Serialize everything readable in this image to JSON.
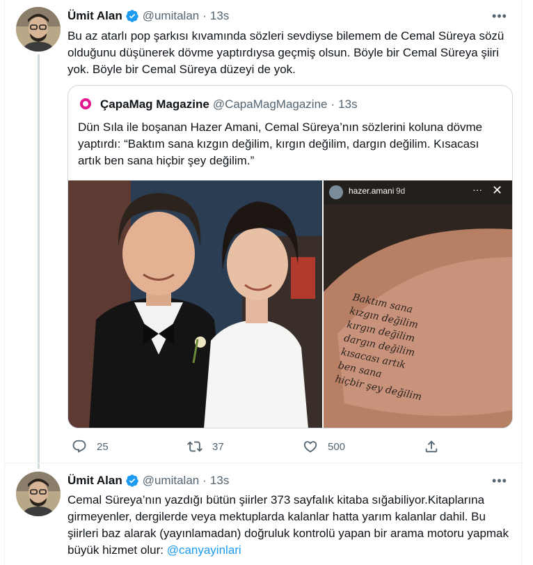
{
  "tweets": [
    {
      "author": {
        "name": "Ümit Alan",
        "handle": "@umitalan",
        "dot": "·",
        "time": "13s"
      },
      "more": "•••",
      "text": "Bu az atarlı pop şarkısı kıvamında sözleri sevdiyse bilemem de Cemal Süreya sözü olduğunu düşünerek dövme yaptırdıysa geçmiş olsun. Böyle bir Cemal Süreya şiiri yok. Böyle bir Cemal Süreya düzeyi de yok.",
      "quote": {
        "author": {
          "name": "ÇapaMag Magazine",
          "handle": "@CapaMagMagazine",
          "dot": "·",
          "time": "13s"
        },
        "text": "Dün Sıla ile boşanan Hazer Amani, Cemal Süreya’nın sözlerini koluna dövme yaptırdı: “Baktım sana kızgın değilim, kırgın değilim, dargın değilim. Kısacası artık ben sana hiçbir şey değilim.”",
        "story": {
          "user": "hazer.amani",
          "age": "9d",
          "more": "···",
          "close": "✕"
        },
        "tattoo_lines": [
          "Baktım sana",
          "kızgın değilim",
          "kırgın değilim",
          "dargın değilim",
          "kısacası artık",
          "ben sana",
          "hiçbir şey değilim"
        ]
      },
      "stats": {
        "replies": "25",
        "retweets": "37",
        "likes": "500"
      }
    },
    {
      "author": {
        "name": "Ümit Alan",
        "handle": "@umitalan",
        "dot": "·",
        "time": "13s"
      },
      "more": "•••",
      "text": "Cemal Süreya’nın yazdığı bütün şiirler 373 sayfalık kitaba sığabiliyor.Kitaplarına girmeyenler, dergilerde veya mektuplarda kalanlar hatta yarım kalanlar dahil. Bu şiirleri baz alarak (yayınlamadan) doğruluk kontrolü yapan bir arama motoru yapmak büyük hizmet olur: ",
      "mention": "@canyayinlari"
    }
  ],
  "colors": {
    "verified": "#1d9bf0",
    "muted": "#536471",
    "border": "#cfd9de",
    "link": "#1d9bf0",
    "capamag_logo": "#e4158f"
  },
  "icons": [
    "verified-badge-icon",
    "more-icon",
    "reply-icon",
    "retweet-icon",
    "like-icon",
    "share-icon",
    "close-icon"
  ]
}
